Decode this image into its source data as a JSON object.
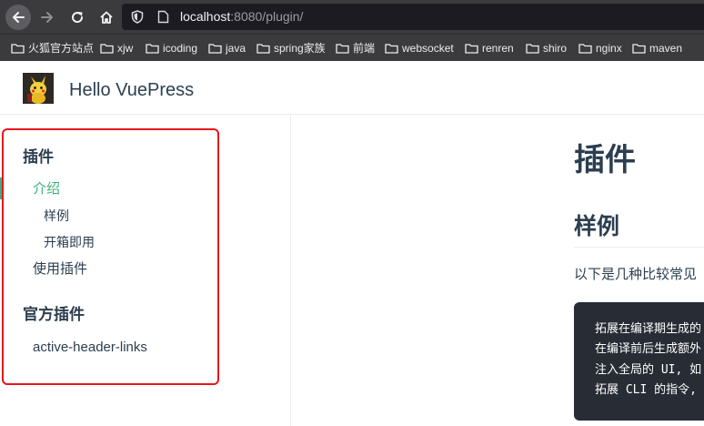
{
  "browser": {
    "url_host": "localhost",
    "url_rest": ":8080/plugin/",
    "icons": [
      "back-icon",
      "forward-icon",
      "reload-icon",
      "home-icon",
      "shield-icon",
      "page-icon",
      "folder-icon"
    ],
    "bookmarks": [
      "火狐官方站点",
      "xjw",
      "icoding",
      "java",
      "spring家族",
      "前端",
      "websocket",
      "renren",
      "shiro",
      "nginx",
      "maven"
    ]
  },
  "site": {
    "name": "Hello VuePress"
  },
  "sidebar": {
    "groups": [
      {
        "title": "插件",
        "items": [
          {
            "label": "介绍",
            "active": true,
            "children": [
              "样例",
              "开箱即用"
            ]
          },
          {
            "label": "使用插件"
          }
        ]
      },
      {
        "title": "官方插件",
        "items": [
          {
            "label": "active-header-links"
          }
        ]
      }
    ]
  },
  "content": {
    "h1": "插件",
    "h2": "样例",
    "paragraph": "以下是几种比较常见",
    "code_lines": [
      "拓展在编译期生成的",
      "在编译前后生成额外",
      "注入全局的 UI, 如",
      "拓展 CLI 的指令,"
    ]
  },
  "colors": {
    "accent": "#3eaf7c",
    "text": "#2c3e50",
    "highlight_border": "#e8161b",
    "browser_chrome": "#3b3b3e",
    "code_bg": "#282c34"
  }
}
